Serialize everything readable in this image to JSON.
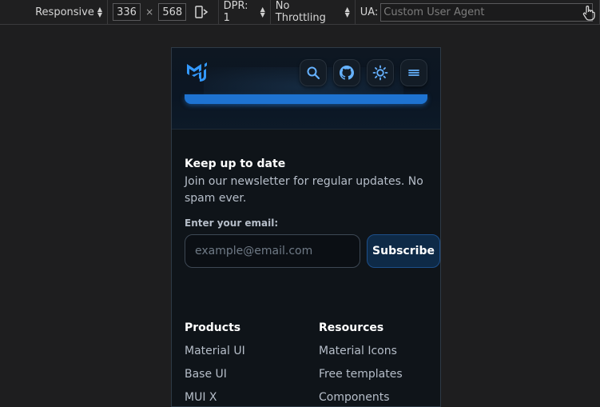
{
  "toolbar": {
    "device_mode": "Responsive",
    "width": "336",
    "times": "×",
    "height": "568",
    "dpr": "DPR: 1",
    "throttling": "No Throttling",
    "ua_label": "UA:",
    "ua_placeholder": "Custom User Agent"
  },
  "newsletter": {
    "title": "Keep up to date",
    "description": "Join our newsletter for regular updates. No spam ever.",
    "email_label": "Enter your email:",
    "email_placeholder": "example@email.com",
    "subscribe_label": "Subscribe"
  },
  "footer": {
    "products": {
      "heading": "Products",
      "links": [
        "Material UI",
        "Base UI",
        "MUI X"
      ]
    },
    "resources": {
      "heading": "Resources",
      "links": [
        "Material Icons",
        "Free templates",
        "Components"
      ]
    }
  },
  "colors": {
    "accent": "#1e73d1",
    "logo": "#3399ff",
    "background": "#0f1419"
  },
  "icons": {
    "header": [
      "search-icon",
      "github-icon",
      "theme-toggle-icon",
      "menu-icon"
    ]
  }
}
